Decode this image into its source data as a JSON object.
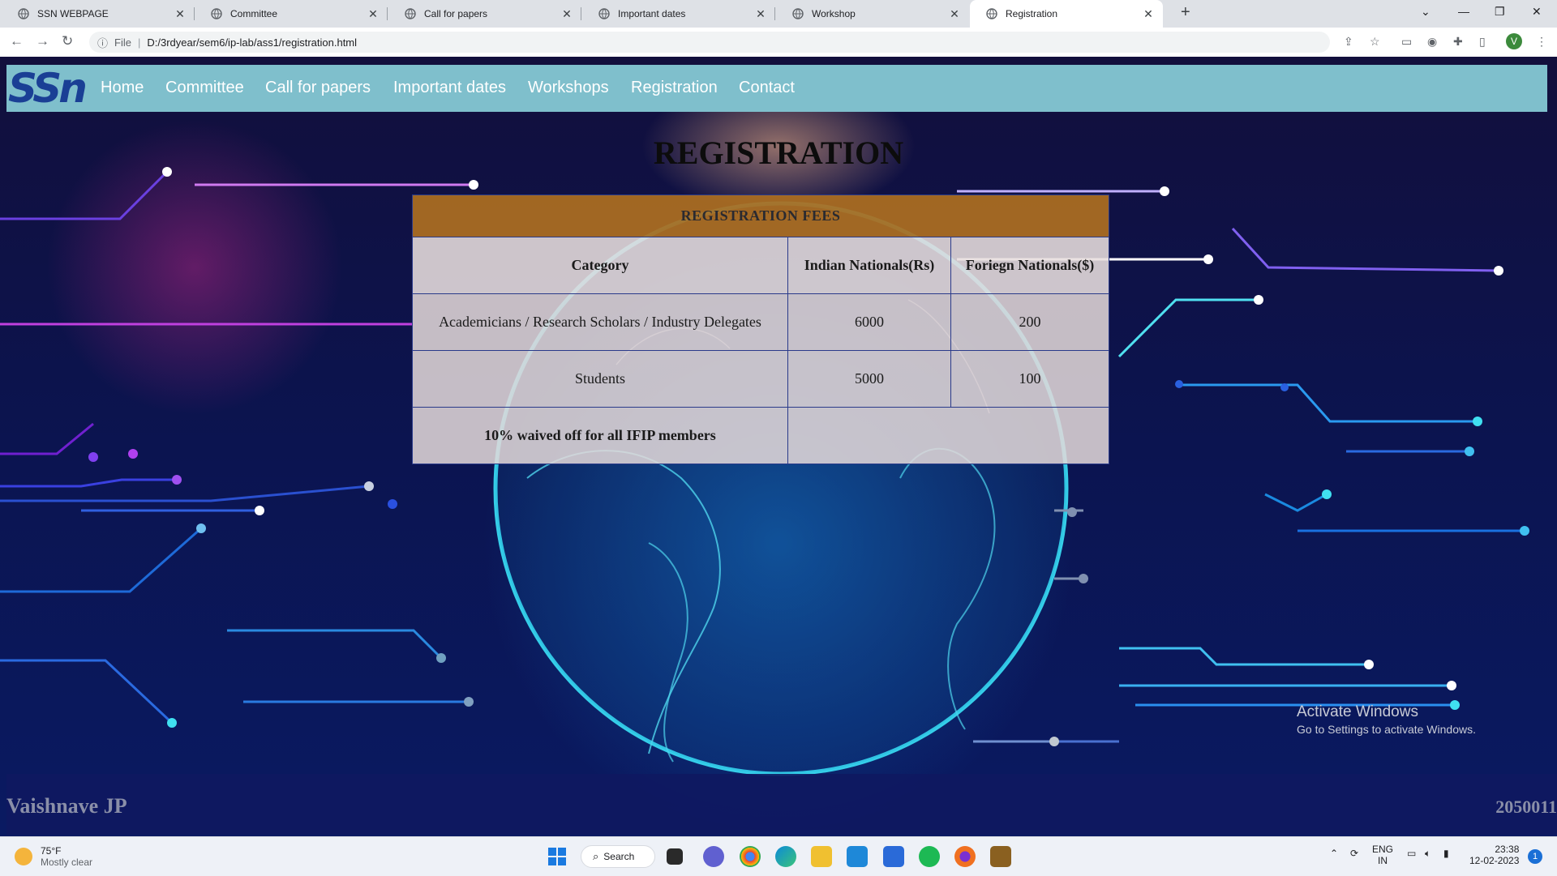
{
  "browser": {
    "tabs": [
      {
        "label": "SSN WEBPAGE"
      },
      {
        "label": "Committee"
      },
      {
        "label": "Call for papers"
      },
      {
        "label": "Important dates"
      },
      {
        "label": "Workshop"
      },
      {
        "label": "Registration",
        "active": true
      }
    ],
    "address_prefix": "File",
    "url": "D:/3rdyear/sem6/ip-lab/ass1/registration.html",
    "profile_initial": "V"
  },
  "site": {
    "logo_text": "SSn",
    "nav": [
      "Home",
      "Committee",
      "Call for papers",
      "Important dates",
      "Workshops",
      "Registration",
      "Contact"
    ],
    "page_title": "REGISTRATION",
    "fees_table": {
      "caption": "REGISTRATION FEES",
      "headers": [
        "Category",
        "Indian Nationals(Rs)",
        "Foriegn Nationals($)"
      ],
      "rows": [
        [
          "Academicians / Research Scholars / Industry Delegates",
          "6000",
          "200"
        ],
        [
          "Students",
          "5000",
          "100"
        ]
      ],
      "note": "10% waived off for all IFIP members"
    },
    "footer": {
      "name": "Vaishnave JP",
      "roll": "2050011"
    }
  },
  "os": {
    "watermark_title": "Activate Windows",
    "watermark_sub": "Go to Settings to activate Windows.",
    "weather_temp": "75°F",
    "weather_desc": "Mostly clear",
    "search_label": "Search",
    "lang_line1": "ENG",
    "lang_line2": "IN",
    "time": "23:38",
    "date": "12-02-2023",
    "notification_count": "1"
  },
  "colors": {
    "header_bg": "#7fbfcc",
    "caption_bg": "#ac6e20",
    "logo_blue": "#1a3f95",
    "circuit_cyan": "#38d8f0",
    "circuit_blue": "#2a5cf0",
    "circuit_magenta": "#c040e0"
  }
}
